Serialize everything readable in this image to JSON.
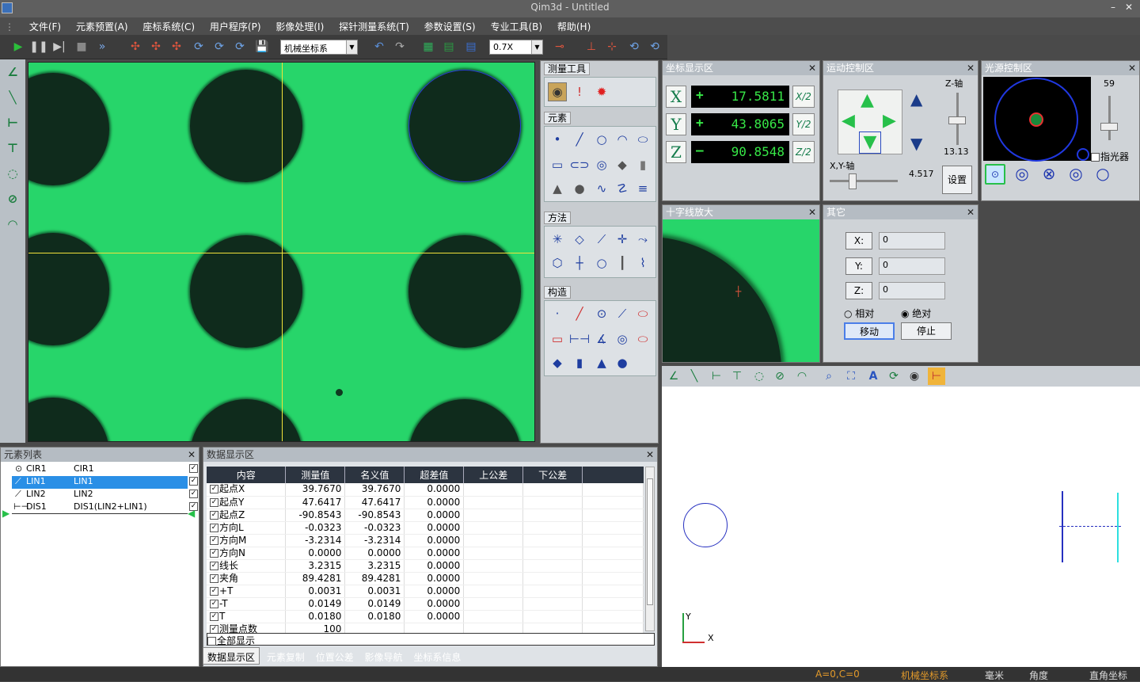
{
  "window": {
    "title": "Qim3d - Untitled"
  },
  "menu": [
    "文件(F)",
    "元素预置(A)",
    "座标系统(C)",
    "用户程序(P)",
    "影像处理(I)",
    "探针测量系统(T)",
    "参数设置(S)",
    "专业工具(B)",
    "帮助(H)"
  ],
  "toolbar": {
    "coord_system": "机械坐标系",
    "zoom": "0.7X"
  },
  "tool_panel": {
    "measure_tools": "测量工具",
    "elements": "元素",
    "methods": "方法",
    "construct": "构造"
  },
  "coord_panel": {
    "title": "坐标显示区",
    "rows": [
      {
        "axis": "X",
        "sign": "+",
        "value": "17.5811",
        "half": "X/2"
      },
      {
        "axis": "Y",
        "sign": "+",
        "value": "43.8065",
        "half": "Y/2"
      },
      {
        "axis": "Z",
        "sign": "–",
        "value": "90.8548",
        "half": "Z/2"
      }
    ]
  },
  "motion_panel": {
    "title": "运动控制区",
    "z_axis": "Z-轴",
    "z_value": "13.13",
    "xy_axis": "X,Y-轴",
    "xy_value": "4.517",
    "settings_button": "设置"
  },
  "light_panel": {
    "title": "光源控制区",
    "level": "59",
    "indicator_label": "指光器"
  },
  "zoom_panel": {
    "title": "十字线放大"
  },
  "other_panel": {
    "title": "其它",
    "fields": [
      {
        "label": "X:",
        "value": "0"
      },
      {
        "label": "Y:",
        "value": "0"
      },
      {
        "label": "Z:",
        "value": "0"
      }
    ],
    "relative": "相对",
    "absolute": "绝对",
    "move_button": "移动",
    "stop_button": "停止"
  },
  "element_list": {
    "title": "元素列表",
    "items": [
      {
        "name": "CIR1",
        "desc": "CIR1"
      },
      {
        "name": "LIN1",
        "desc": "LIN1"
      },
      {
        "name": "LIN2",
        "desc": "LIN2"
      },
      {
        "name": "DIS1",
        "desc": "DIS1(LIN2+LIN1)"
      }
    ]
  },
  "data_panel": {
    "title": "数据显示区",
    "columns": [
      "内容",
      "测量值",
      "名义值",
      "超差值",
      "上公差",
      "下公差"
    ],
    "rows": [
      {
        "name": "起点X",
        "measured": "39.7670",
        "nominal": "39.7670",
        "dev": "0.0000"
      },
      {
        "name": "起点Y",
        "measured": "47.6417",
        "nominal": "47.6417",
        "dev": "0.0000"
      },
      {
        "name": "起点Z",
        "measured": "-90.8543",
        "nominal": "-90.8543",
        "dev": "0.0000"
      },
      {
        "name": "方向L",
        "measured": "-0.0323",
        "nominal": "-0.0323",
        "dev": "0.0000"
      },
      {
        "name": "方向M",
        "measured": "-3.2314",
        "nominal": "-3.2314",
        "dev": "0.0000"
      },
      {
        "name": "方向N",
        "measured": "0.0000",
        "nominal": "0.0000",
        "dev": "0.0000"
      },
      {
        "name": "线长",
        "measured": "3.2315",
        "nominal": "3.2315",
        "dev": "0.0000"
      },
      {
        "name": "夹角",
        "measured": "89.4281",
        "nominal": "89.4281",
        "dev": "0.0000"
      },
      {
        "name": "+T",
        "measured": "0.0031",
        "nominal": "0.0031",
        "dev": "0.0000"
      },
      {
        "name": "-T",
        "measured": "0.0149",
        "nominal": "0.0149",
        "dev": "0.0000"
      },
      {
        "name": "T",
        "measured": "0.0180",
        "nominal": "0.0180",
        "dev": "0.0000"
      },
      {
        "name": "测量点数",
        "measured": "100",
        "nominal": "",
        "dev": ""
      }
    ],
    "show_all": "全部显示"
  },
  "tabs": [
    "数据显示区",
    "元素复制",
    "位置公差",
    "影像导航",
    "坐标系信息"
  ],
  "graph": {
    "axis_y": "Y",
    "axis_x": "X"
  },
  "status": {
    "ac": "A=0,C=0",
    "coord": "机械坐标系",
    "unit": "毫米",
    "angle": "角度",
    "mode": "直角坐标"
  }
}
